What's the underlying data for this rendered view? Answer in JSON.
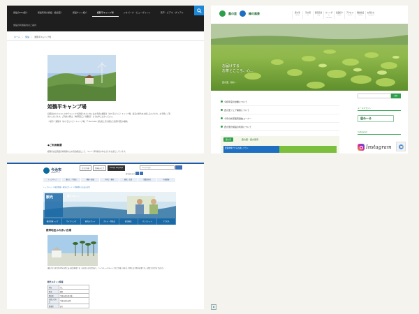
{
  "panel1": {
    "nav_items": [
      "施設のFAQ紹介",
      "施設利用の施設（会館室）",
      "施設サイト紹介",
      "姫鶴平キャンプ場",
      "ジオパーク・ビューポイント",
      "音声・ビデオ・ダイアル"
    ],
    "nav_sub": "施設の利用案内のご案内",
    "breadcrumb": [
      "ホーム",
      "施設",
      "姫鶴平キャンプ場"
    ],
    "title": "姫鶴平キャンプ場",
    "body_1": "四国最大のカルストの中でキャンプを満喫されたい方にはお手頃な姫鶴平（めづるだいら）キャンプ場。最高の景色をお楽しみいただき、お手軽にご利用いただけます。ご利用の際は、事務所窓口（姫鶴荘）までお申し込みください。",
    "body_2": "〈住所〉「姫鶴平（めづるだいら）キャンプ場」〒785-1601 高知県上浮穴郡久万高原町西谷4番地",
    "h2": "◆ご利用概要",
    "h2_body": "姫鶴荘は四国最高峰規模の山の宿泊施設として、キャンプ利用者のみなさまをお迎えしています。"
  },
  "panel2": {
    "logo_1": "農の里",
    "logo_2": "緑の風景",
    "nav": [
      {
        "jp": "農の里",
        "en": "about"
      },
      {
        "jp": "茶の国",
        "en": "tea"
      },
      {
        "jp": "農家民泊",
        "en": "stay"
      },
      {
        "jp": "カレンダー",
        "en": "calendar"
      },
      {
        "jp": "商品紹介",
        "en": "items"
      },
      {
        "jp": "アクセス",
        "en": "access"
      },
      {
        "jp": "関連施設",
        "en": "facility"
      },
      {
        "jp": "お問合せ",
        "en": "contact"
      }
    ],
    "hero_line1": "お届けする",
    "hero_line2": "お茶とこころ、心...",
    "hero_sub": "農の里、緑の...",
    "list": [
      "令和年度の営業について",
      "農の里フェア開催について",
      "今年の新茶販売開始コーナー",
      "農の里の施設の利用について"
    ],
    "banner_tag": "農の里",
    "banner_title": "農の里・農の風景",
    "banner_strip": "農業体験できるお試しプラン",
    "search_button": "検索",
    "side_heading_1": "メールマガジン",
    "mail_text": "届め〜る",
    "side_heading_2": "Instagram",
    "ig_word": "Instagram"
  },
  "panel3": {
    "logo_name": "今治市",
    "logo_en": "IMABARI CITY",
    "util": [
      "文字と背景",
      "音声読み上げ",
      "Foreign language"
    ],
    "google_placeholder": "Google 検索",
    "size_label": "文字の大きさ",
    "navbar": [
      "トップページ",
      "暮らし・手続き",
      "健康・福祉",
      "子育て・教育",
      "観光・文化",
      "事業者向け",
      "市政情報"
    ],
    "crumb": "トップページ > 観光情報 > 観光スポット > 携帯地区ふれあい広場",
    "banner_label": "観光",
    "banner_sub": "観光スポット",
    "tabs": [
      "観光情報トップ",
      "サイクリング",
      "観光スポット",
      "グルメ・特産品",
      "宿泊施設",
      "パンフレット",
      "アクセス"
    ],
    "h1": "携帯地区ふれあい広場",
    "desc": "東伯方から車で約10分の所にある宿泊施設です。海の見える広場があり、バーベキューやキャンプなどが楽しめます。利用には予約が必要です。お問い合わせは下記まで。",
    "info_heading": "観光スポット情報",
    "table": [
      {
        "k": "所在",
        "v": "なし"
      },
      {
        "k": "料金",
        "v": "無料"
      },
      {
        "k": "所在地",
        "v": "今治市伯方町木浦"
      },
      {
        "k": "お問い合わせ",
        "v": "今治市伯方支所"
      },
      {
        "k": "駐車場",
        "v": "あり"
      }
    ]
  },
  "colors": {
    "p1_nav_bg": "#1e1e1e",
    "p1_search": "#1e88d6",
    "p2_green": "#2e9e4a",
    "p3_blue": "#1a69a7"
  }
}
